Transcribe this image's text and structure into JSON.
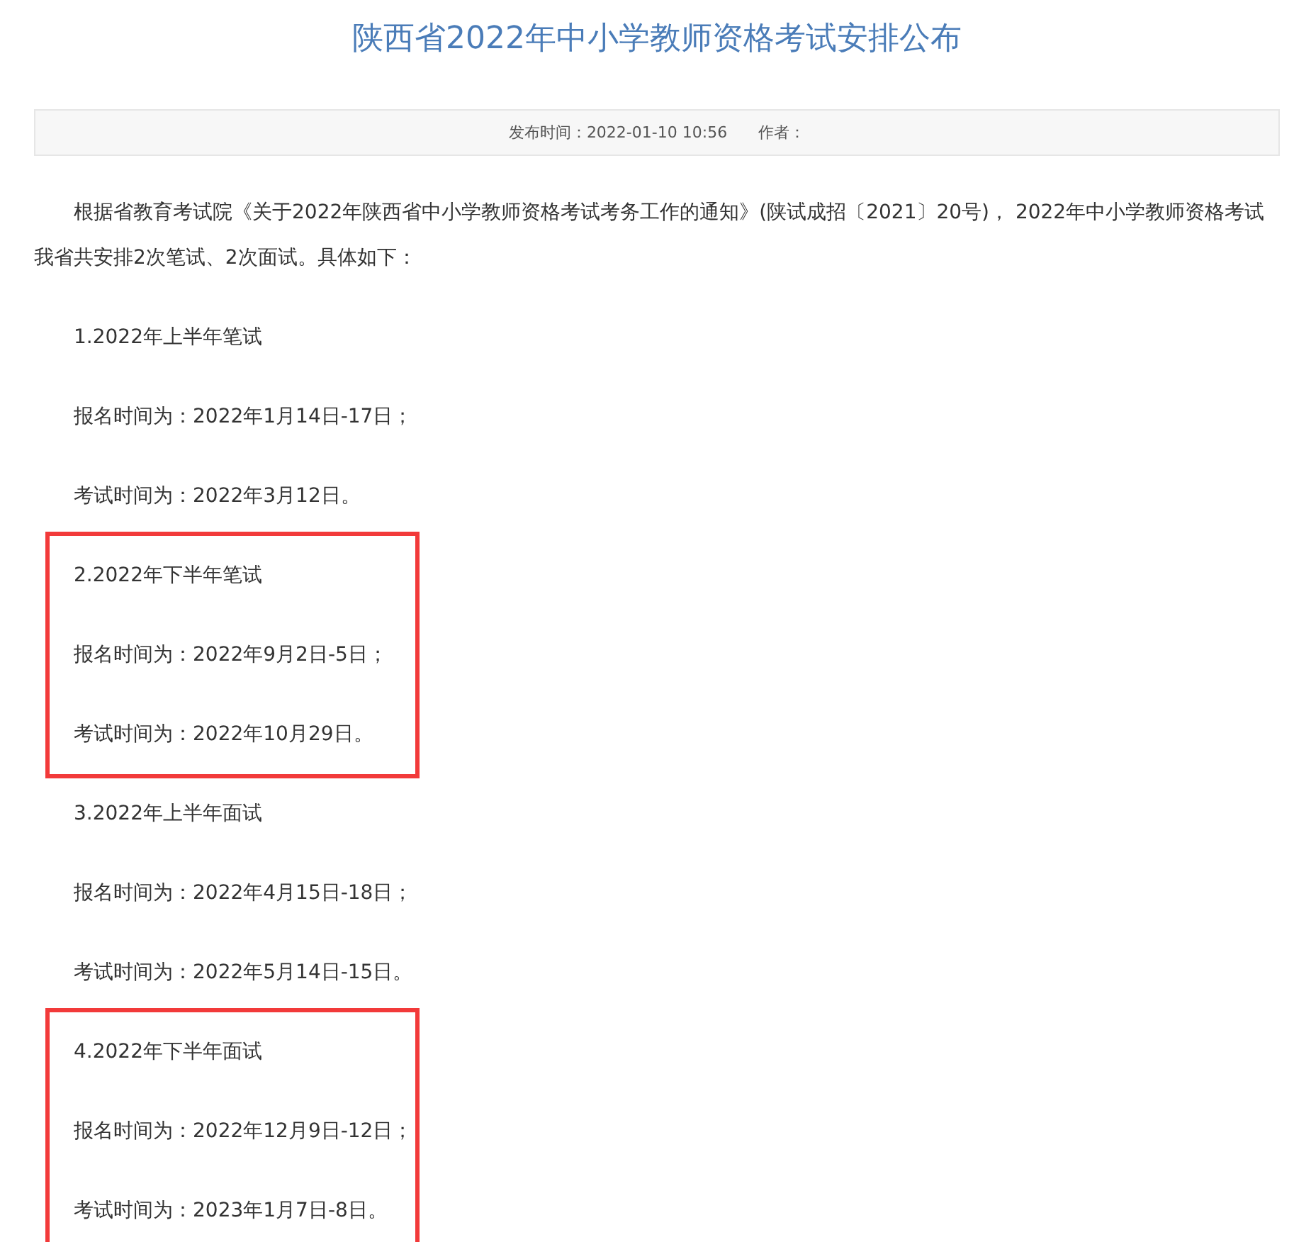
{
  "title": "陕西省2022年中小学教师资格考试安排公布",
  "meta": {
    "published": "发布时间：2022-01-10 10:56",
    "author": "作者："
  },
  "intro": "根据省教育考试院《关于2022年陕西省中小学教师资格考试考务工作的通知》(陕试成招〔2021〕20号)， 2022年中小学教师资格考试我省共安排2次笔试、2次面试。具体如下：",
  "sections": [
    {
      "highlighted": false,
      "lines": [
        "1.2022年上半年笔试",
        "报名时间为：2022年1月14日-17日；",
        "考试时间为：2022年3月12日。"
      ]
    },
    {
      "highlighted": true,
      "lines": [
        "2.2022年下半年笔试",
        "报名时间为：2022年9月2日-5日；",
        "考试时间为：2022年10月29日。"
      ]
    },
    {
      "highlighted": false,
      "lines": [
        "3.2022年上半年面试",
        "报名时间为：2022年4月15日-18日；",
        "考试时间为：2022年5月14日-15日。"
      ]
    },
    {
      "highlighted": true,
      "lines": [
        "4.2022年下半年面试",
        "报名时间为：2022年12月9日-12日；",
        "考试时间为：2023年1月7日-8日。"
      ]
    }
  ]
}
